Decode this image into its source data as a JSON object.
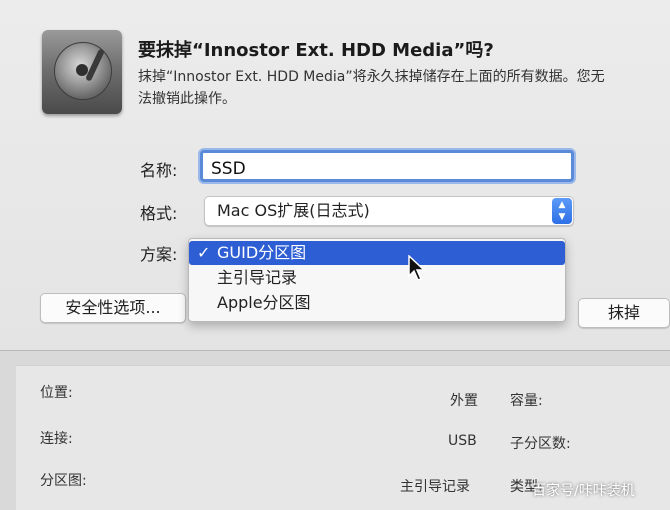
{
  "dialog": {
    "title": "要抹掉“Innostor Ext. HDD Media”吗?",
    "description_line1": "抹掉“Innostor Ext. HDD Media”将永久抹掉储存在上面的所有数据。您无",
    "description_line2": "法撤销此操作。",
    "disk_icon": "hard-drive-icon"
  },
  "form": {
    "name_label": "名称:",
    "name_value": "SSD",
    "format_label": "格式:",
    "format_value": "Mac OS扩展(日志式)",
    "scheme_label": "方案:",
    "scheme_menu": {
      "check_mark": "✓",
      "items": [
        "GUID分区图",
        "主引导记录",
        "Apple分区图"
      ],
      "selected_index": 0
    }
  },
  "buttons": {
    "security_options": "安全性选项...",
    "erase": "抹掉"
  },
  "info_panel": {
    "location_label": "位置:",
    "location_value": "外置",
    "connection_label": "连接:",
    "connection_value": "USB",
    "partition_map_label": "分区图:",
    "partition_map_value": "主引导记录",
    "capacity_label": "容量:",
    "child_count_label": "子分区数:",
    "type_label": "类型:"
  },
  "watermark": "百家号/咔咔装机",
  "colors": {
    "accent": "#2e5ed4",
    "focus_ring": "#5a8ad8",
    "stepper": "#2d6fe6"
  }
}
